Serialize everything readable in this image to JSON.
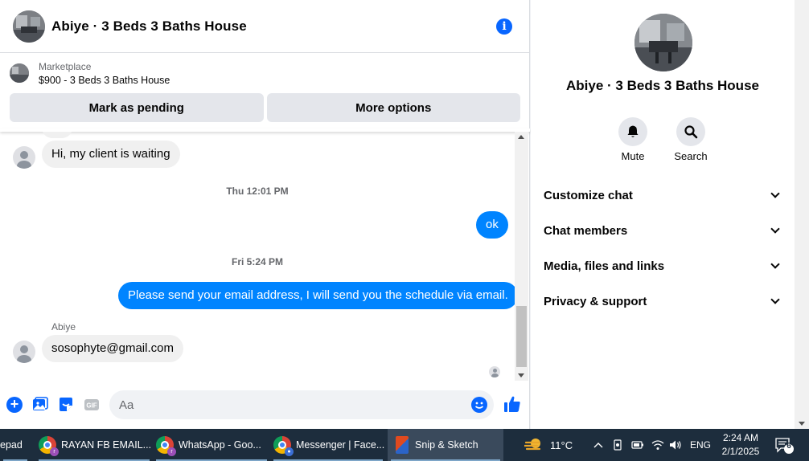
{
  "chat": {
    "title": "Abiye · 3 Beds 3 Baths House",
    "marketplace_label": "Marketplace",
    "listing": "$900 - 3 Beds 3 Baths House",
    "buttons": {
      "mark_pending": "Mark as pending",
      "more_options": "More options"
    }
  },
  "messages": {
    "msg1": "Hi, my client is waiting",
    "time1": "Thu 12:01 PM",
    "msg2": "ok",
    "time2": "Fri 5:24 PM",
    "msg3": "Please send your email address, I will send you the schedule via email.",
    "sender": "Abiye",
    "msg4": "sosophyte@gmail.com"
  },
  "composer": {
    "placeholder": "Aa",
    "value": ""
  },
  "info": {
    "title": "Abiye · 3 Beds 3 Baths House",
    "mute_label": "Mute",
    "search_label": "Search",
    "sections": [
      "Customize chat",
      "Chat members",
      "Media, files and links",
      "Privacy & support"
    ]
  },
  "taskbar": {
    "notepad": "epad",
    "tab1": "RAYAN FB EMAIL...",
    "tab2": "WhatsApp - Goo...",
    "tab3": "Messenger | Face...",
    "tab4": "Snip & Sketch",
    "badge_letter": "r",
    "temperature": "11°C",
    "language": "ENG",
    "time": "2:24 AM",
    "date": "2/1/2025",
    "notification_count": "6"
  },
  "colors": {
    "accent": "#0866ff",
    "outgoing_bubble": "#0084ff",
    "incoming_bubble": "#f0f0f0",
    "taskbar": "#1d2d3d"
  }
}
